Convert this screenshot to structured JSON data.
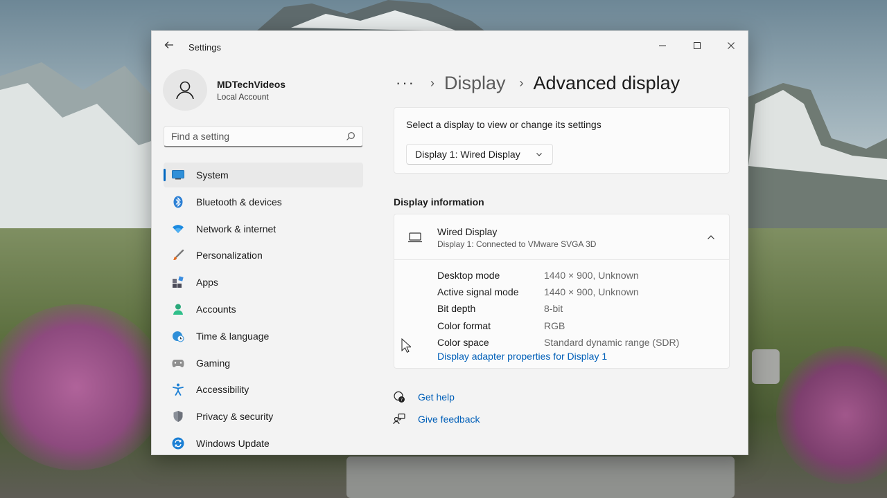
{
  "window": {
    "title": "Settings"
  },
  "profile": {
    "name": "MDTechVideos",
    "account_type": "Local Account"
  },
  "search": {
    "placeholder": "Find a setting"
  },
  "sidebar": {
    "items": [
      {
        "label": "System",
        "icon": "system-icon",
        "active": true
      },
      {
        "label": "Bluetooth & devices",
        "icon": "bluetooth-icon"
      },
      {
        "label": "Network & internet",
        "icon": "wifi-icon"
      },
      {
        "label": "Personalization",
        "icon": "brush-icon"
      },
      {
        "label": "Apps",
        "icon": "apps-icon"
      },
      {
        "label": "Accounts",
        "icon": "accounts-icon"
      },
      {
        "label": "Time & language",
        "icon": "globe-clock-icon"
      },
      {
        "label": "Gaming",
        "icon": "gamepad-icon"
      },
      {
        "label": "Accessibility",
        "icon": "accessibility-icon"
      },
      {
        "label": "Privacy & security",
        "icon": "shield-icon"
      },
      {
        "label": "Windows Update",
        "icon": "update-icon"
      }
    ]
  },
  "breadcrumb": {
    "more": "···",
    "parent": "Display",
    "current": "Advanced display"
  },
  "display_select": {
    "prompt": "Select a display to view or change its settings",
    "selected": "Display 1: Wired Display"
  },
  "display_info": {
    "section_title": "Display information",
    "title": "Wired Display",
    "subtitle": "Display 1: Connected to VMware SVGA 3D",
    "rows": [
      {
        "label": "Desktop mode",
        "value": "1440 × 900, Unknown"
      },
      {
        "label": "Active signal mode",
        "value": "1440 × 900, Unknown"
      },
      {
        "label": "Bit depth",
        "value": "8-bit"
      },
      {
        "label": "Color format",
        "value": "RGB"
      },
      {
        "label": "Color space",
        "value": "Standard dynamic range (SDR)"
      }
    ],
    "adapter_link": "Display adapter properties for Display 1"
  },
  "help": {
    "get_help": "Get help",
    "give_feedback": "Give feedback"
  },
  "colors": {
    "accent": "#0067c0",
    "link": "#005fb8"
  }
}
